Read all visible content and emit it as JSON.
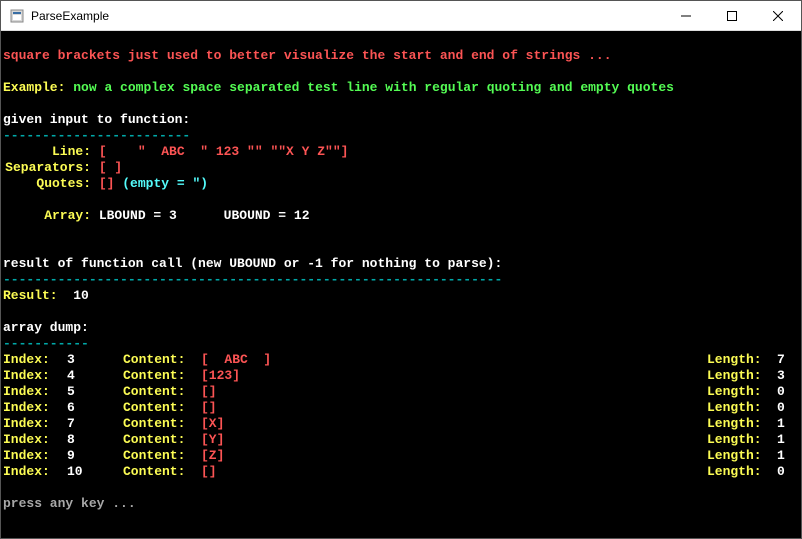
{
  "window": {
    "title": "ParseExample"
  },
  "header": {
    "note": "square brackets just used to better visualize the start and end of strings ...",
    "example_label": "Example:",
    "example_text": "now a complex space separated test line with regular quoting and empty quotes"
  },
  "given": {
    "title": "given input to function:",
    "rule": "------------------------",
    "line_label": "Line:",
    "line_value": "[    \"  ABC  \" 123 \"\" \"\"X Y Z\"\"]",
    "sep_label": "Separators:",
    "sep_value": "[ ]",
    "quotes_label": "Quotes:",
    "quotes_value": "[]",
    "quotes_note": "(empty = \")",
    "array_label": "Array:",
    "lbound_label": "LBOUND =",
    "lbound_value": "3",
    "ubound_label": "UBOUND =",
    "ubound_value": "12"
  },
  "result": {
    "title": "result of function call (new UBOUND or -1 for nothing to parse):",
    "rule": "----------------------------------------------------------------",
    "label": "Result:",
    "value": "10"
  },
  "dump": {
    "title": "array dump:",
    "rule": "-----------",
    "index_label": "Index:",
    "content_label": "Content:",
    "length_label": "Length:",
    "rows": [
      {
        "index": "3",
        "content": "[  ABC  ]",
        "length": "7"
      },
      {
        "index": "4",
        "content": "[123]",
        "length": "3"
      },
      {
        "index": "5",
        "content": "[]",
        "length": "0"
      },
      {
        "index": "6",
        "content": "[]",
        "length": "0"
      },
      {
        "index": "7",
        "content": "[X]",
        "length": "1"
      },
      {
        "index": "8",
        "content": "[Y]",
        "length": "1"
      },
      {
        "index": "9",
        "content": "[Z]",
        "length": "1"
      },
      {
        "index": "10",
        "content": "[]",
        "length": "0"
      }
    ]
  },
  "footer": {
    "press": "press any key ..."
  }
}
